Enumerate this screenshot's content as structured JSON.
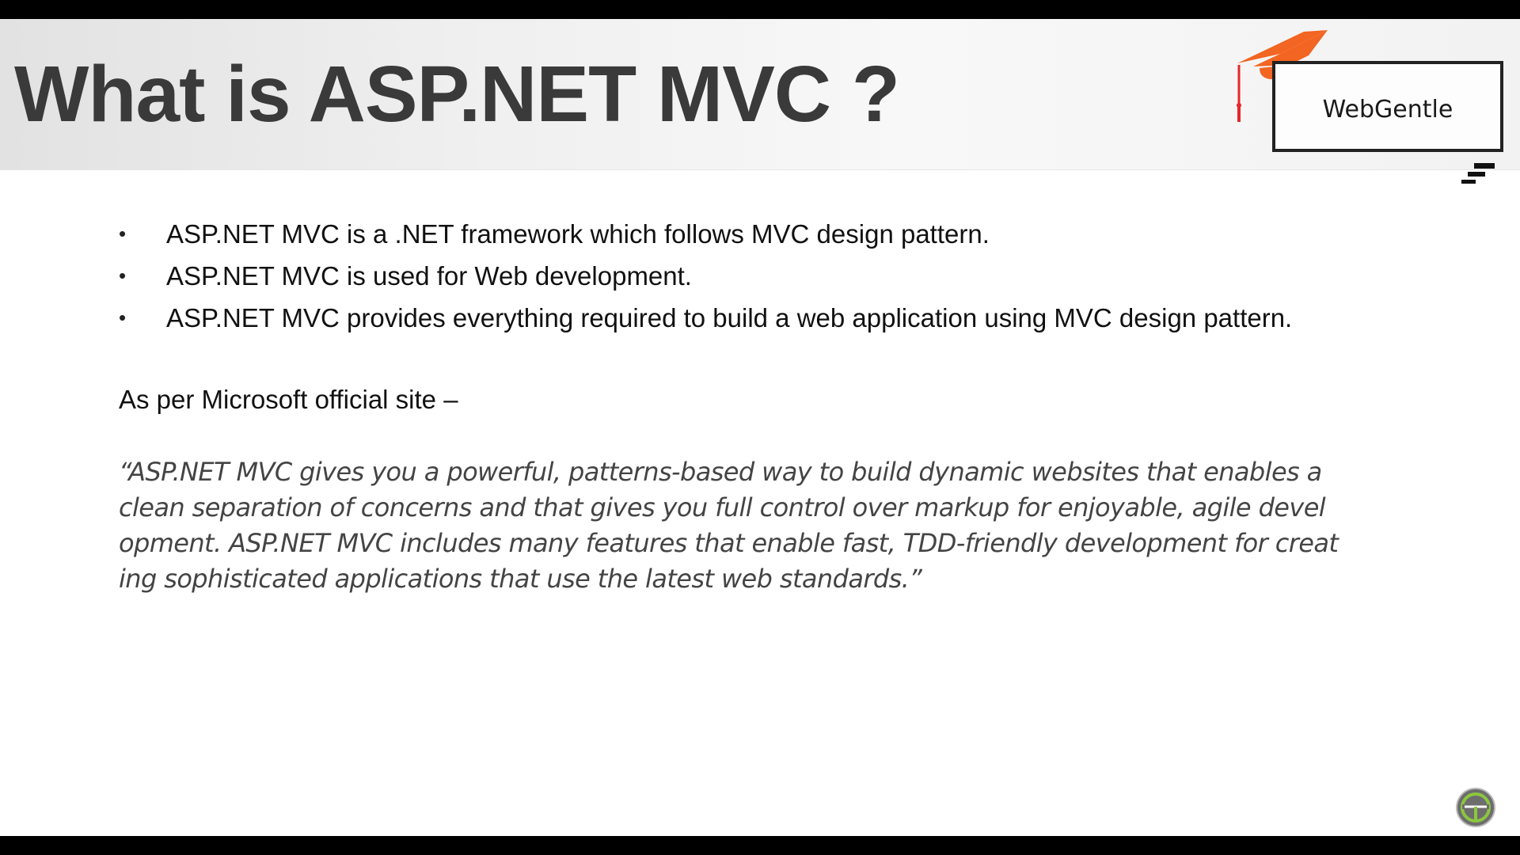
{
  "slide": {
    "title": "What is ASP.NET MVC ?",
    "logo_text": "WebGentle",
    "bullet_marker": "•",
    "bullets": [
      {
        "text": "ASP.NET MVC is a .NET framework which follows MVC design pattern."
      },
      {
        "text": "ASP.NET MVC is used for Web development."
      },
      {
        "text": "ASP.NET MVC provides everything required to build a web application using MVC design pattern."
      }
    ],
    "source_label": "As per Microsoft official site –",
    "quote_lines": [
      "“ASP.NET MVC gives you a powerful, patterns-based way to build dynamic websites that enables a",
      "clean separation of concerns and that gives you full control over markup for enjoyable, agile devel",
      "opment. ASP.NET MVC includes many features that enable fast, TDD-friendly development for creat",
      "ing sophisticated applications that use the latest web standards.”"
    ]
  },
  "colors": {
    "title": "#3a3a3a",
    "logo_cap": "#f26522",
    "logo_tassel": "#e8262a",
    "text": "#111111",
    "quote": "#444444",
    "badge_ring": "#8cc63f"
  },
  "icons": {
    "logo_cap": "graduation-cap-icon",
    "logo_stairs": "stairs-icon",
    "corner_badge": "webgentle-badge-icon"
  }
}
